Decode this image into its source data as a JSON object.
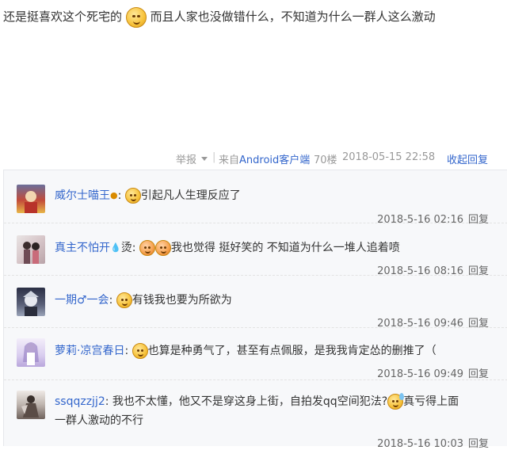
{
  "post": {
    "text_part1": "还是挺喜欢这个死宅的",
    "text_part2": "而且人家也没做错什么，不知道为什么一群人这么激动"
  },
  "meta": {
    "report": "举报",
    "separator": "|",
    "from_prefix": "来自",
    "source": "Android客户端",
    "floor": "70楼",
    "datetime": "2018-05-15 22:58",
    "collapse": "收起回复"
  },
  "replies": [
    {
      "user": "威尔士喵王",
      "badge": "♂",
      "colon": ":",
      "text": "引起凡人生理反应了",
      "date": "2018-5-16 02:16",
      "reply_label": "回复"
    },
    {
      "user": "真主不怕开",
      "badge": "烫",
      "colon": ":",
      "text": "我也觉得 挺好笑的 不知道为什么一堆人追着喷",
      "date": "2018-5-16 08:16",
      "reply_label": "回复"
    },
    {
      "user": "一期♂一会",
      "colon": ":",
      "text": "有钱我也要为所欲为",
      "date": "2018-5-16 09:46",
      "reply_label": "回复"
    },
    {
      "user": "萝莉·凉宫春日",
      "colon": ":",
      "text": "也算是种勇气了，甚至有点佩服，是我我肯定怂的删推了（",
      "date": "2018-5-16 09:49",
      "reply_label": "回复"
    },
    {
      "user": "ssqqzzjj2",
      "colon": ":",
      "text": "我也不太懂，他又不是穿这身上街，自拍发qq空间犯法?",
      "text_after_emoji": "真亏得上面",
      "text_line2": "一群人激动的不行",
      "date": "2018-5-16 10:03",
      "reply_label": "回复"
    }
  ],
  "colors": {
    "link": "#3366cc",
    "meta_gray": "#999999",
    "reply_bg": "#f7f8fa"
  },
  "icons": [
    "smile-emoji",
    "angry-emoji",
    "sweat-emoji",
    "caret-down-icon",
    "fire-badge-icon",
    "water-badge-icon"
  ]
}
